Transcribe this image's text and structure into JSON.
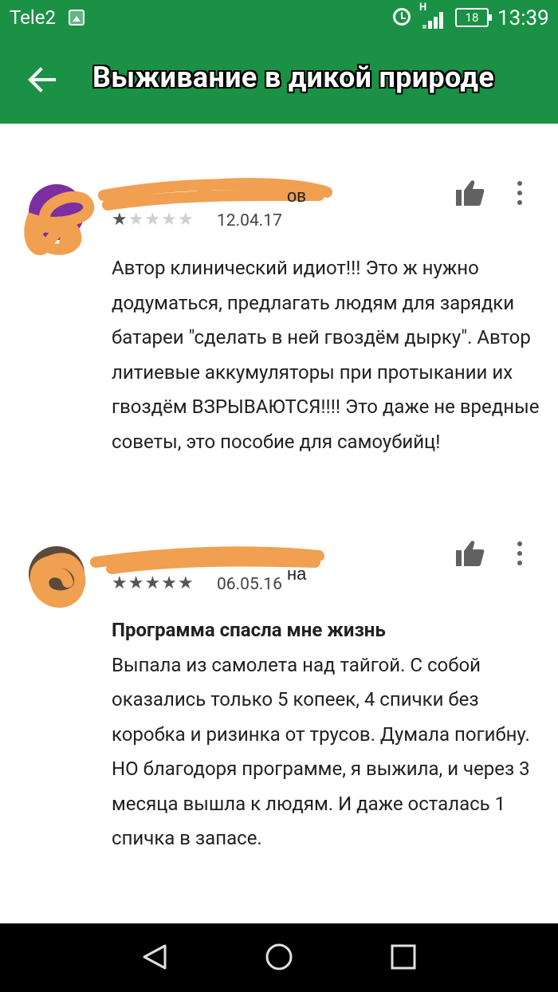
{
  "status_bar": {
    "carrier": "Tele2",
    "battery": "18",
    "network": "H",
    "time": "13:39"
  },
  "toolbar": {
    "title": "Выживание в дикой природе",
    "back_icon": "arrow-left-icon"
  },
  "reviews": [
    {
      "author": "██████████ ██████ов",
      "rating": 1,
      "max_rating": 5,
      "date": "12.04.17",
      "title": "",
      "text": "Автор клинический идиот!!! Это ж нужно додуматься, предлагать людям для зарядки батареи \"сделать в ней гвоздём дырку\". Автор литиевые аккумуляторы при протыкании их гвоздём ВЗРЫВАЮТСЯ!!!! Это даже не вредные советы, это пособие для самоубийц!",
      "avatar_color": "#7b2fa3"
    },
    {
      "author": "██████ ███████████на",
      "rating": 5,
      "max_rating": 5,
      "date": "06.05.16",
      "title": "Программа спасла мне жизнь",
      "text": "Выпала из самолета над тайгой. С собой оказались только 5 копеек, 4 спички без коробка и ризинка от трусов. Думала погибну. НО благодоря программе, я выжила, и через 3 месяца вышла к людям. И даже осталась 1 спичка в запасе.",
      "avatar_color": "#5a4a3a"
    }
  ],
  "colors": {
    "toolbar_bg": "#1a9145",
    "scribble": "#f0a050",
    "navbar_bg": "#000000"
  },
  "nav": {
    "back_icon": "triangle-back-icon",
    "home_icon": "circle-home-icon",
    "recents_icon": "square-recents-icon"
  }
}
